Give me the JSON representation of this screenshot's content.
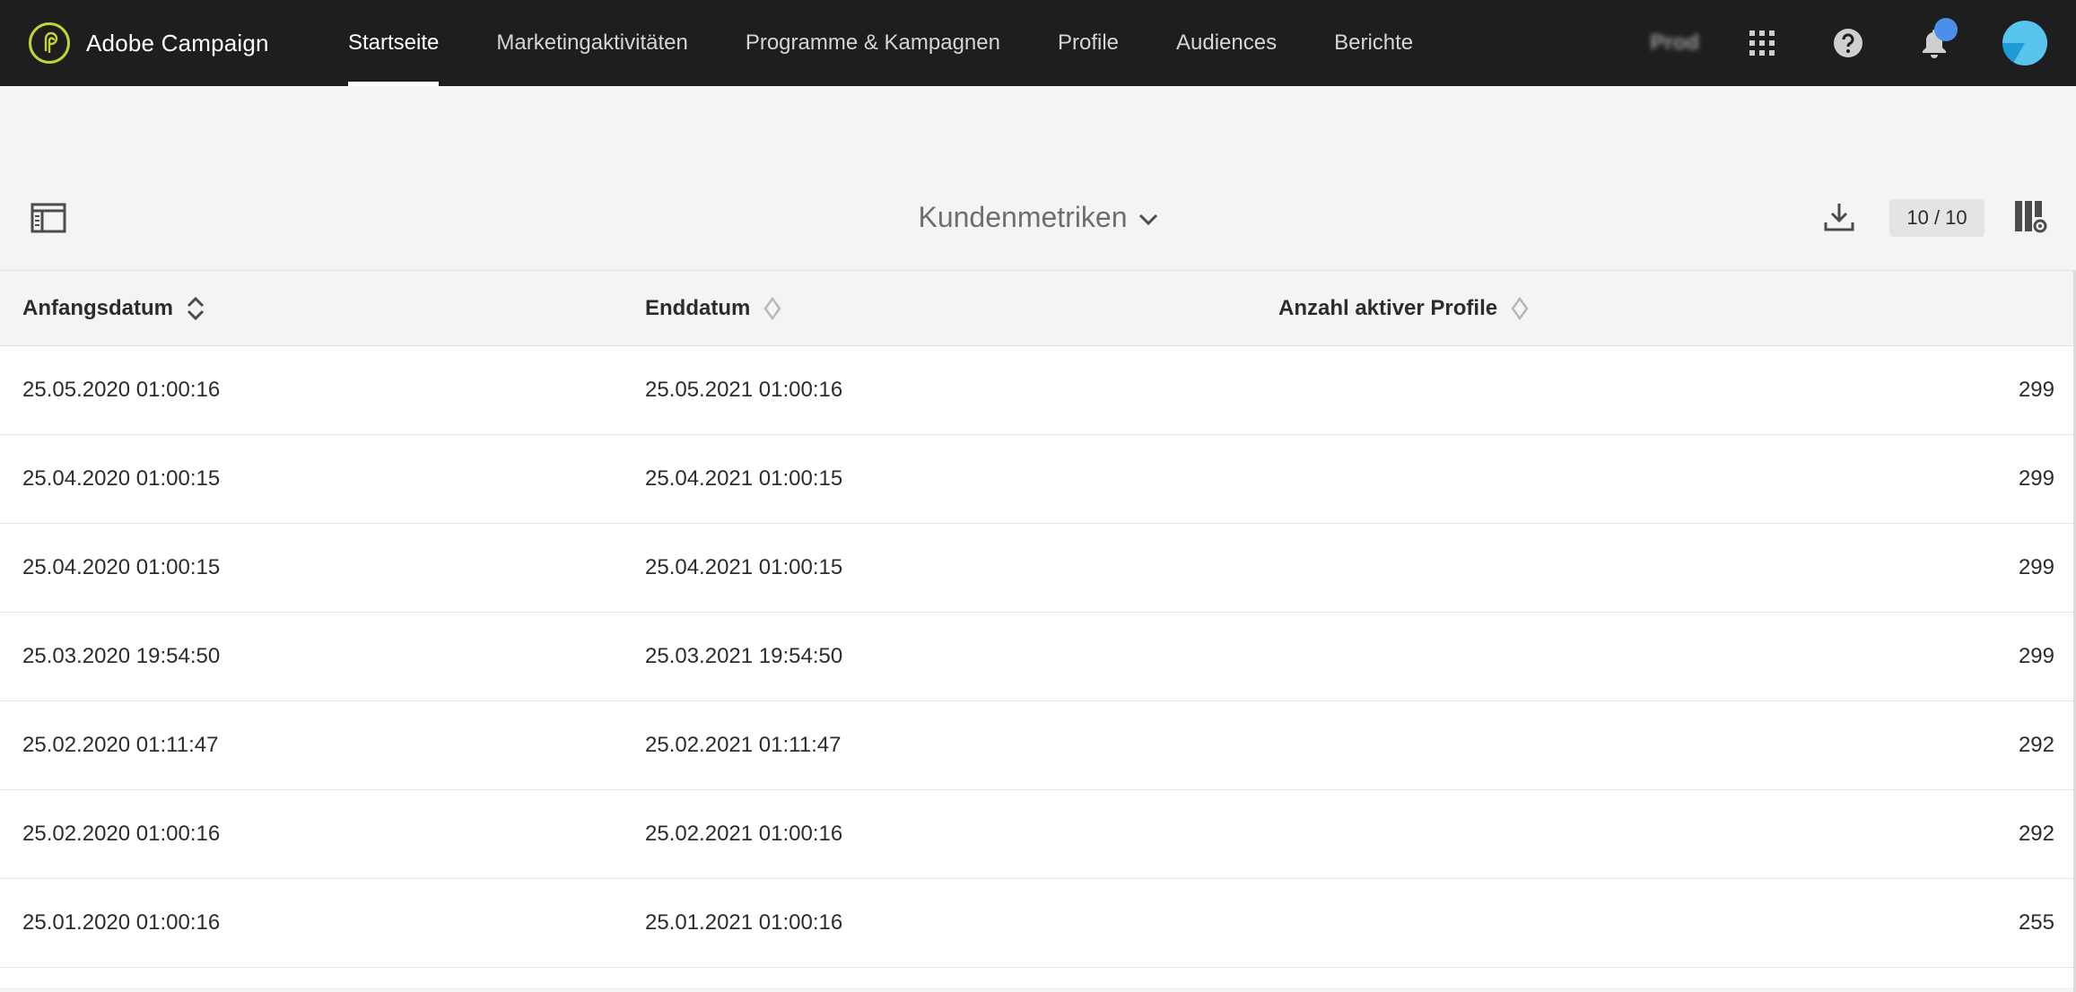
{
  "app": {
    "name": "Adobe Campaign",
    "environment": "Prod"
  },
  "nav": {
    "items": [
      {
        "label": "Startseite",
        "active": true
      },
      {
        "label": "Marketingaktivitäten",
        "active": false
      },
      {
        "label": "Programme & Kampagnen",
        "active": false
      },
      {
        "label": "Profile",
        "active": false
      },
      {
        "label": "Audiences",
        "active": false
      },
      {
        "label": "Berichte",
        "active": false
      }
    ]
  },
  "header_icons": [
    "apps-grid-icon",
    "help-icon",
    "bell-icon",
    "avatar"
  ],
  "toolbar": {
    "view_title": "Kundenmetriken",
    "count": "10 / 10"
  },
  "table": {
    "columns": [
      "Anfangsdatum",
      "Enddatum",
      "Anzahl aktiver Profile"
    ],
    "rows": [
      [
        "25.05.2020 01:00:16",
        "25.05.2021 01:00:16",
        "299"
      ],
      [
        "25.04.2020 01:00:15",
        "25.04.2021 01:00:15",
        "299"
      ],
      [
        "25.04.2020 01:00:15",
        "25.04.2021 01:00:15",
        "299"
      ],
      [
        "25.03.2020 19:54:50",
        "25.03.2021 19:54:50",
        "299"
      ],
      [
        "25.02.2020 01:11:47",
        "25.02.2021 01:11:47",
        "292"
      ],
      [
        "25.02.2020 01:00:16",
        "25.02.2021 01:00:16",
        "292"
      ],
      [
        "25.01.2020 01:00:16",
        "25.01.2021 01:00:16",
        "255"
      ]
    ]
  },
  "colors": {
    "topbar": "#1e1e1e",
    "accent_logo": "#c5d435",
    "notification": "#4c8fea",
    "page_background": "#f4f4f4"
  }
}
